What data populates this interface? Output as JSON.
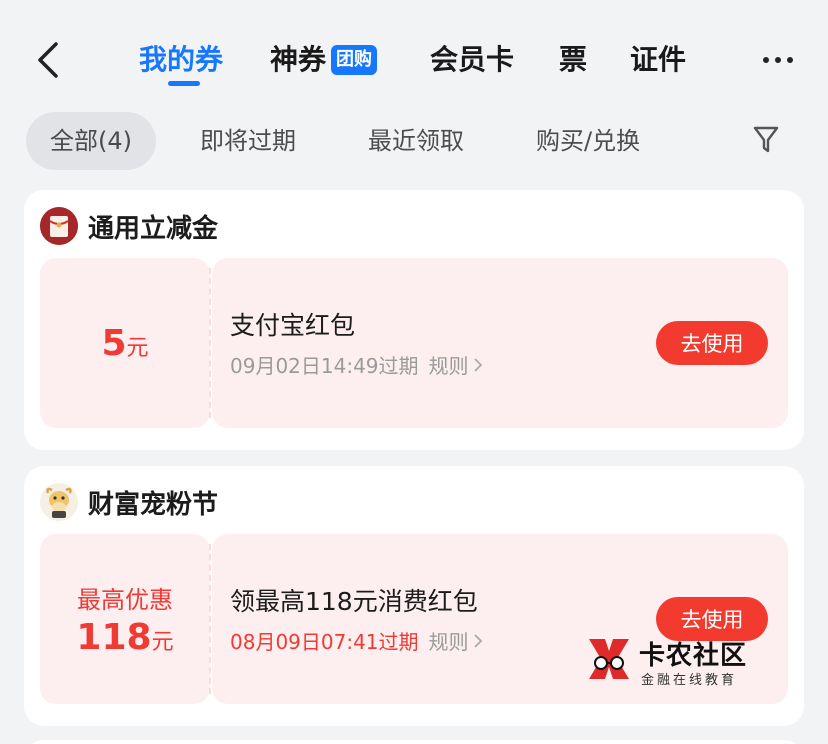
{
  "nav": {
    "back_icon": "chevron-left-icon",
    "tabs": [
      {
        "label": "我的券",
        "active": true
      },
      {
        "label": "神券",
        "badge": "团购"
      },
      {
        "label": "会员卡"
      },
      {
        "label": "票"
      },
      {
        "label": "证件"
      }
    ],
    "more_icon": "more-dots-icon"
  },
  "filters": {
    "chips": [
      "全部(4)",
      "即将过期",
      "最近领取",
      "购买/兑换"
    ],
    "active_index": 0,
    "filter_icon": "funnel-icon"
  },
  "sections": [
    {
      "title": "通用立减金",
      "icon": "red-envelope-icon",
      "coupon": {
        "amount": "5",
        "unit": "元",
        "name": "支付宝红包",
        "expire": "09月02日14:49过期",
        "rules": "规则",
        "button": "去使用"
      }
    },
    {
      "title": "财富宠粉节",
      "icon": "cow-mascot-icon",
      "coupon": {
        "amount_label": "最高优惠",
        "amount": "118",
        "unit": "元",
        "name": "领最高118元消费红包",
        "expire": "08月09日07:41过期",
        "rules": "规则",
        "button": "去使用"
      }
    }
  ],
  "watermark": {
    "title": "卡农社区",
    "subtitle": "金融在线教育"
  },
  "colors": {
    "accent": "#1677ff",
    "red": "#ef3b34",
    "coupon_bg": "#fdeff0",
    "page_bg": "#f2f3f5"
  }
}
